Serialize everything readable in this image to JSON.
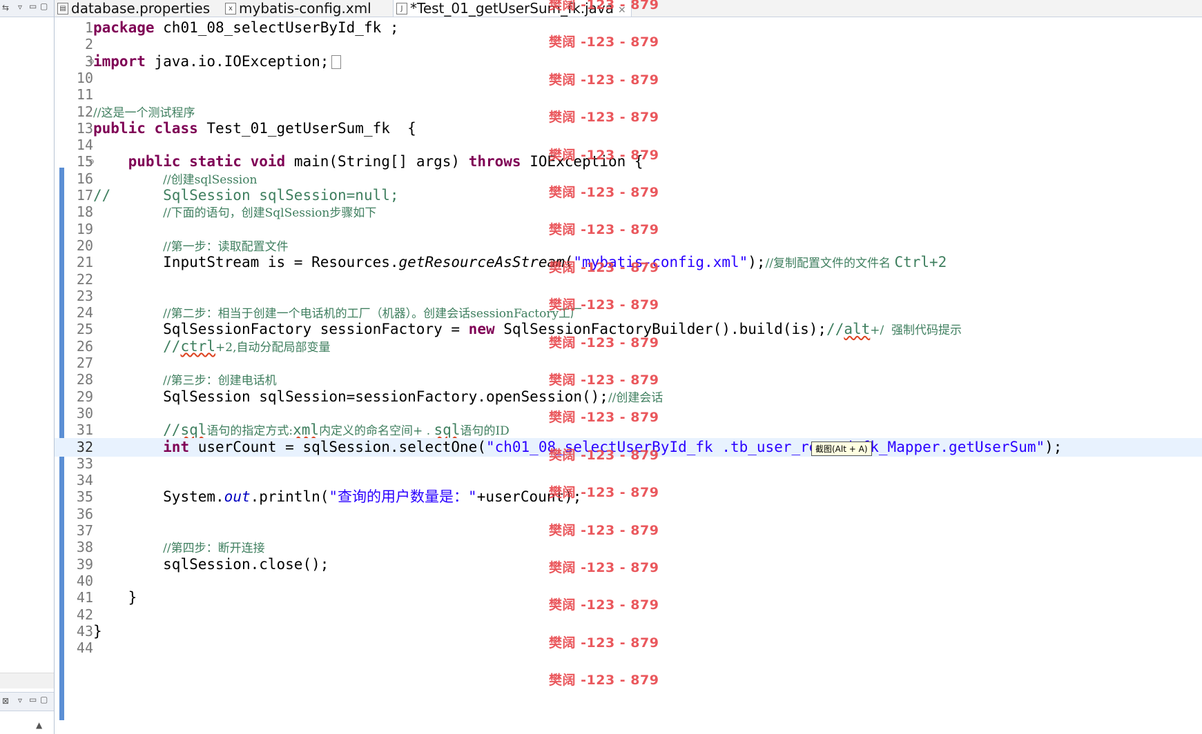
{
  "tabs": [
    {
      "icon": "properties-file-icon",
      "label": "database.properties",
      "active": false
    },
    {
      "icon": "xml-file-icon",
      "label": "mybatis-config.xml",
      "active": false
    },
    {
      "icon": "java-file-icon",
      "label": "*Test_01_getUserSum_fk.java",
      "active": true,
      "close": "✕"
    }
  ],
  "lines": [
    {
      "n": "1",
      "k": "l1"
    },
    {
      "n": "2",
      "k": "blank"
    },
    {
      "n": "3",
      "k": "l3"
    },
    {
      "n": "10",
      "k": "blank"
    },
    {
      "n": "11",
      "k": "blank"
    },
    {
      "n": "12",
      "k": "l12"
    },
    {
      "n": "13",
      "k": "l13"
    },
    {
      "n": "14",
      "k": "blank"
    },
    {
      "n": "15",
      "k": "l15"
    },
    {
      "n": "16",
      "k": "l16"
    },
    {
      "n": "17",
      "k": "l17"
    },
    {
      "n": "18",
      "k": "l18"
    },
    {
      "n": "19",
      "k": "blank"
    },
    {
      "n": "20",
      "k": "l20"
    },
    {
      "n": "21",
      "k": "l21"
    },
    {
      "n": "22",
      "k": "blank"
    },
    {
      "n": "23",
      "k": "blank"
    },
    {
      "n": "24",
      "k": "l24"
    },
    {
      "n": "25",
      "k": "l25"
    },
    {
      "n": "26",
      "k": "l26"
    },
    {
      "n": "27",
      "k": "blank"
    },
    {
      "n": "28",
      "k": "l28"
    },
    {
      "n": "29",
      "k": "l29"
    },
    {
      "n": "30",
      "k": "blank"
    },
    {
      "n": "31",
      "k": "l31"
    },
    {
      "n": "32",
      "k": "l32"
    },
    {
      "n": "33",
      "k": "blank"
    },
    {
      "n": "34",
      "k": "blank"
    },
    {
      "n": "35",
      "k": "l35"
    },
    {
      "n": "36",
      "k": "blank"
    },
    {
      "n": "37",
      "k": "blank"
    },
    {
      "n": "38",
      "k": "l38"
    },
    {
      "n": "39",
      "k": "l39"
    },
    {
      "n": "40",
      "k": "blank"
    },
    {
      "n": "41",
      "k": "l41"
    },
    {
      "n": "42",
      "k": "blank"
    },
    {
      "n": "43",
      "k": "l43"
    },
    {
      "n": "44",
      "k": "blank"
    }
  ],
  "code": {
    "l1": {
      "kw": "package",
      "rest": " ch01_08_selectUserById_fk ;"
    },
    "l3": {
      "kw": "import",
      "rest": " java.io.IOException;"
    },
    "l12": {
      "cm": "//这是一个测试程序"
    },
    "l13": {
      "kw1": "public",
      "kw2": "class",
      "rest": " Test_01_getUserSum_fk  {"
    },
    "l15": {
      "indent": "    ",
      "kw1": "public",
      "kw2": "static",
      "kw3": "void",
      "mid": " main(String[] args) ",
      "kw4": "throws",
      "rest": " IOException {"
    },
    "l16": {
      "indent": "        ",
      "cm": "//创建sqlSession"
    },
    "l17": {
      "cm1": "//",
      "cm2": "      SqlSession sqlSession=null;"
    },
    "l18": {
      "indent": "        ",
      "cm": "//下面的语句，创建SqlSession步骤如下"
    },
    "l20": {
      "indent": "        ",
      "cm": "//第一步：读取配置文件"
    },
    "l21": {
      "indent": "        ",
      "a": "InputStream is = Resources.",
      "it": "getResourceAsStream",
      "b": "(",
      "str": "\"mybatis-config.xml\"",
      "c": ");",
      "cm": "//复制配置文件的文件名 ",
      "cm2": "Ctrl+2"
    },
    "l24": {
      "indent": "        ",
      "cm": "//第二步：相当于创建一个电话机的工厂（机器）。创建会话sessionFactory工厂"
    },
    "l25": {
      "indent": "        ",
      "a": "SqlSessionFactory sessionFactory = ",
      "kw": "new",
      "b": " SqlSessionFactoryBuilder().build(is);",
      "cm": "//",
      "cm2": "alt",
      "cm3": "+/  强制代码提示"
    },
    "l26": {
      "indent": "        ",
      "cm1": "//",
      "cm2": "ctrl",
      "cm3": "+2,自动分配局部变量"
    },
    "l28": {
      "indent": "        ",
      "cm": "//第三步：创建电话机"
    },
    "l29": {
      "indent": "        ",
      "a": "SqlSession sqlSession=sessionFactory.openSession();",
      "cm": "//创建会话"
    },
    "l31": {
      "indent": "        ",
      "cm1": "//",
      "cm2": "sql",
      "cm3": "语句的指定方式:",
      "cm4": "xml",
      "cm5": "内定义的命名空间+ . ",
      "cm6": "sql",
      "cm7": "语句的ID"
    },
    "l32": {
      "indent": "        ",
      "kw": "int",
      "a": " userCount = sqlSession.selectOne(",
      "str": "\"ch01_08_selectUserById_fk .tb_user_record_fk_Mapper.getUserSum\"",
      "b": ");"
    },
    "l35": {
      "indent": "        ",
      "a": "System.",
      "fld": "out",
      "b": ".println(",
      "str": "\"查询的用户数量是：\"",
      "c": "+userCount);"
    },
    "l38": {
      "indent": "        ",
      "cm": "//第四步：断开连接"
    },
    "l39": {
      "indent": "        ",
      "a": "sqlSession.close();"
    },
    "l41": {
      "indent": "    ",
      "a": "}"
    },
    "l43": {
      "a": "}"
    }
  },
  "watermark": {
    "text": "樊阔 -123 - 879",
    "color": "#e8474c",
    "count": 19
  },
  "tooltip": "截图(Alt + A)",
  "current_line": "32",
  "colors": {
    "keyword": "#7f0055",
    "comment": "#3f7f5f",
    "string": "#2a00ff",
    "ruler": "#5b8fd4",
    "current_line": "#e8f2fe"
  }
}
